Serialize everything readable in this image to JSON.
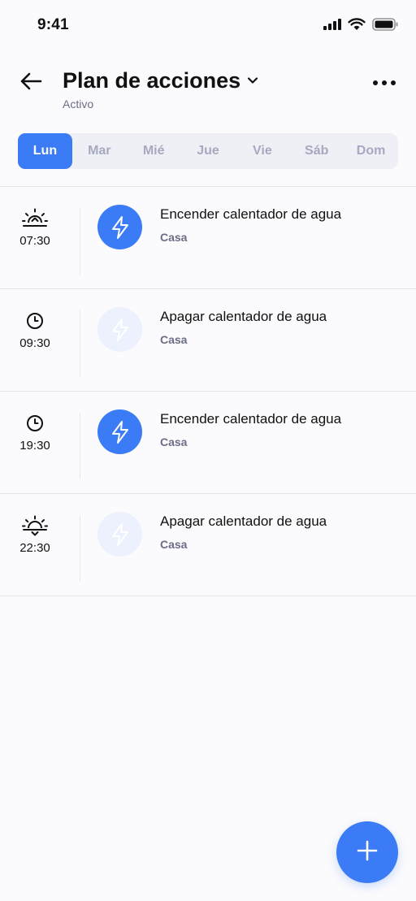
{
  "status_bar": {
    "time": "9:41",
    "icons": [
      "signal-icon",
      "wifi-icon",
      "battery-icon"
    ]
  },
  "header": {
    "title": "Plan de acciones",
    "subtitle": "Activo",
    "back_icon": "arrow-left-icon",
    "dropdown_icon": "chevron-down-icon",
    "more_icon": "more-horizontal-icon"
  },
  "days": [
    {
      "label": "Lun",
      "active": true
    },
    {
      "label": "Mar",
      "active": false
    },
    {
      "label": "Mié",
      "active": false
    },
    {
      "label": "Jue",
      "active": false
    },
    {
      "label": "Vie",
      "active": false
    },
    {
      "label": "Sáb",
      "active": false
    },
    {
      "label": "Dom",
      "active": false
    }
  ],
  "schedule": [
    {
      "time": "07:30",
      "time_icon": "sunrise-icon",
      "action": "Encender calentador de agua",
      "location": "Casa",
      "enabled": true
    },
    {
      "time": "09:30",
      "time_icon": "clock-icon",
      "action": "Apagar calentador de agua",
      "location": "Casa",
      "enabled": false
    },
    {
      "time": "19:30",
      "time_icon": "clock-icon",
      "action": "Encender calentador de agua",
      "location": "Casa",
      "enabled": true
    },
    {
      "time": "22:30",
      "time_icon": "sunset-icon",
      "action": "Apagar calentador de agua",
      "location": "Casa",
      "enabled": false
    }
  ],
  "fab_icon": "plus-icon",
  "colors": {
    "accent": "#3b7bf6",
    "accent_light": "#edf1fd",
    "muted_text": "#6b6d86",
    "tab_bg": "#eef0f6",
    "tab_inactive": "#a6a9bf",
    "background": "#fbfbfd"
  }
}
